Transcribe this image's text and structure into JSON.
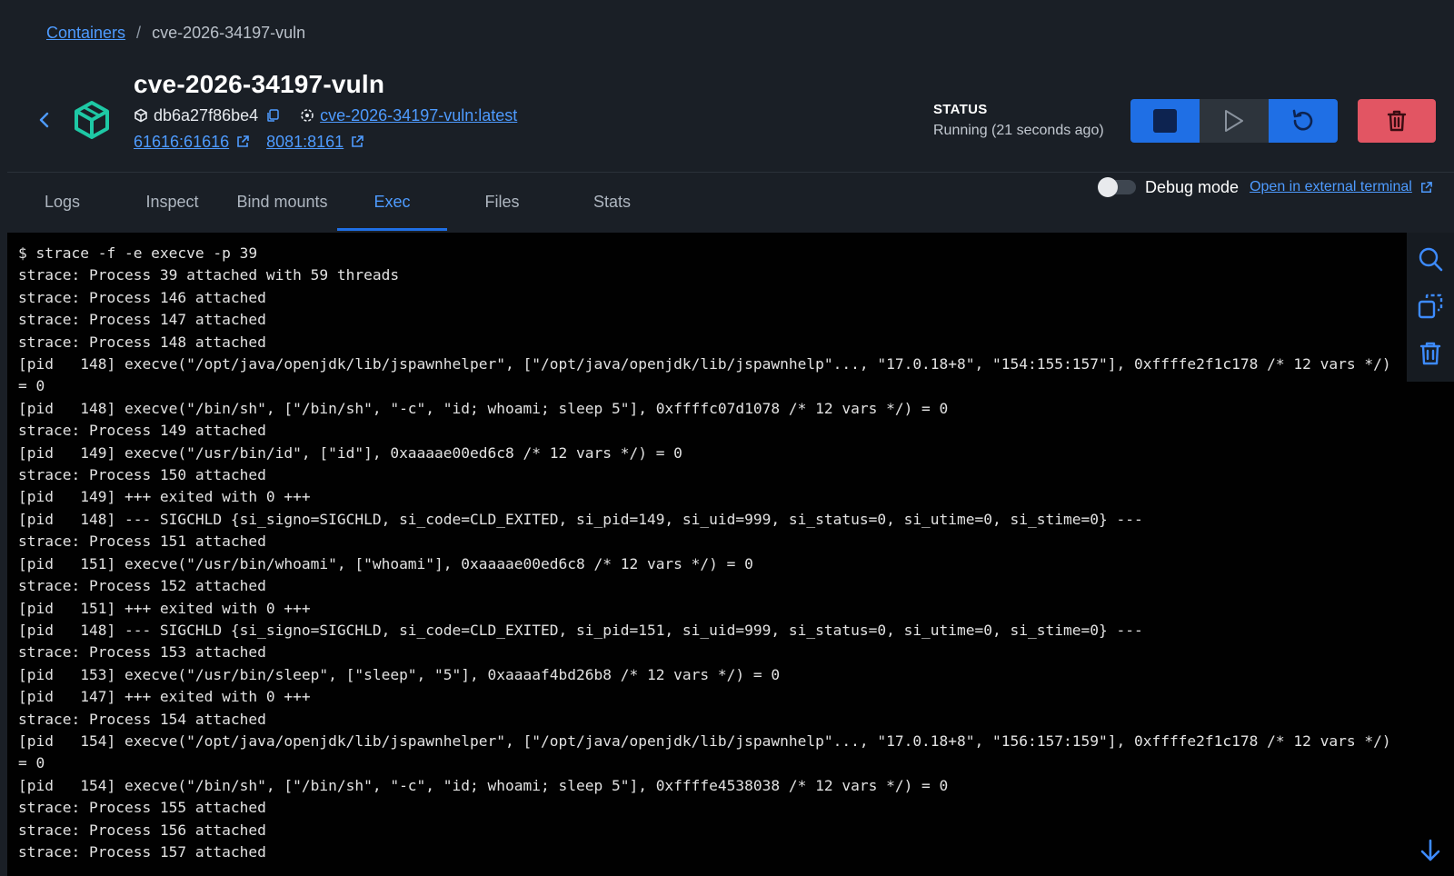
{
  "breadcrumb": {
    "root": "Containers",
    "separator": "/",
    "current": "cve-2026-34197-vuln"
  },
  "container": {
    "name": "cve-2026-34197-vuln",
    "id": "db6a27f86be4",
    "image": "cve-2026-34197-vuln:latest",
    "ports": [
      "61616:61616",
      "8081:8161"
    ]
  },
  "status": {
    "label": "STATUS",
    "value": "Running (21 seconds ago)"
  },
  "actions": [
    "stop",
    "start",
    "restart",
    "delete"
  ],
  "tabs": [
    {
      "label": "Logs"
    },
    {
      "label": "Inspect"
    },
    {
      "label": "Bind mounts"
    },
    {
      "label": "Exec"
    },
    {
      "label": "Files"
    },
    {
      "label": "Stats"
    }
  ],
  "active_tab": "Exec",
  "debug": {
    "label": "Debug mode",
    "external_link": "Open in external terminal",
    "enabled": false
  },
  "terminal": {
    "lines": [
      "$ strace -f -e execve -p 39",
      "strace: Process 39 attached with 59 threads",
      "strace: Process 146 attached",
      "strace: Process 147 attached",
      "strace: Process 148 attached",
      "[pid   148] execve(\"/opt/java/openjdk/lib/jspawnhelper\", [\"/opt/java/openjdk/lib/jspawnhelp\"..., \"17.0.18+8\", \"154:155:157\"], 0xffffe2f1c178 /* 12 vars */) = 0",
      "[pid   148] execve(\"/bin/sh\", [\"/bin/sh\", \"-c\", \"id; whoami; sleep 5\"], 0xffffc07d1078 /* 12 vars */) = 0",
      "strace: Process 149 attached",
      "[pid   149] execve(\"/usr/bin/id\", [\"id\"], 0xaaaae00ed6c8 /* 12 vars */) = 0",
      "strace: Process 150 attached",
      "[pid   149] +++ exited with 0 +++",
      "[pid   148] --- SIGCHLD {si_signo=SIGCHLD, si_code=CLD_EXITED, si_pid=149, si_uid=999, si_status=0, si_utime=0, si_stime=0} ---",
      "strace: Process 151 attached",
      "[pid   151] execve(\"/usr/bin/whoami\", [\"whoami\"], 0xaaaae00ed6c8 /* 12 vars */) = 0",
      "strace: Process 152 attached",
      "[pid   151] +++ exited with 0 +++",
      "[pid   148] --- SIGCHLD {si_signo=SIGCHLD, si_code=CLD_EXITED, si_pid=151, si_uid=999, si_status=0, si_utime=0, si_stime=0} ---",
      "strace: Process 153 attached",
      "[pid   153] execve(\"/usr/bin/sleep\", [\"sleep\", \"5\"], 0xaaaaf4bd26b8 /* 12 vars */) = 0",
      "[pid   147] +++ exited with 0 +++",
      "strace: Process 154 attached",
      "[pid   154] execve(\"/opt/java/openjdk/lib/jspawnhelper\", [\"/opt/java/openjdk/lib/jspawnhelp\"..., \"17.0.18+8\", \"156:157:159\"], 0xffffe2f1c178 /* 12 vars */) = 0",
      "[pid   154] execve(\"/bin/sh\", [\"/bin/sh\", \"-c\", \"id; whoami; sleep 5\"], 0xffffe4538038 /* 12 vars */) = 0",
      "strace: Process 155 attached",
      "strace: Process 156 attached",
      "strace: Process 157 attached"
    ]
  },
  "terminal_tools": [
    "search-icon",
    "copy-icon",
    "trash-icon"
  ],
  "colors": {
    "accent": "#1f6fe5",
    "link": "#4e9bff",
    "danger": "#e25563",
    "container_icon": "#1ec8a5"
  }
}
